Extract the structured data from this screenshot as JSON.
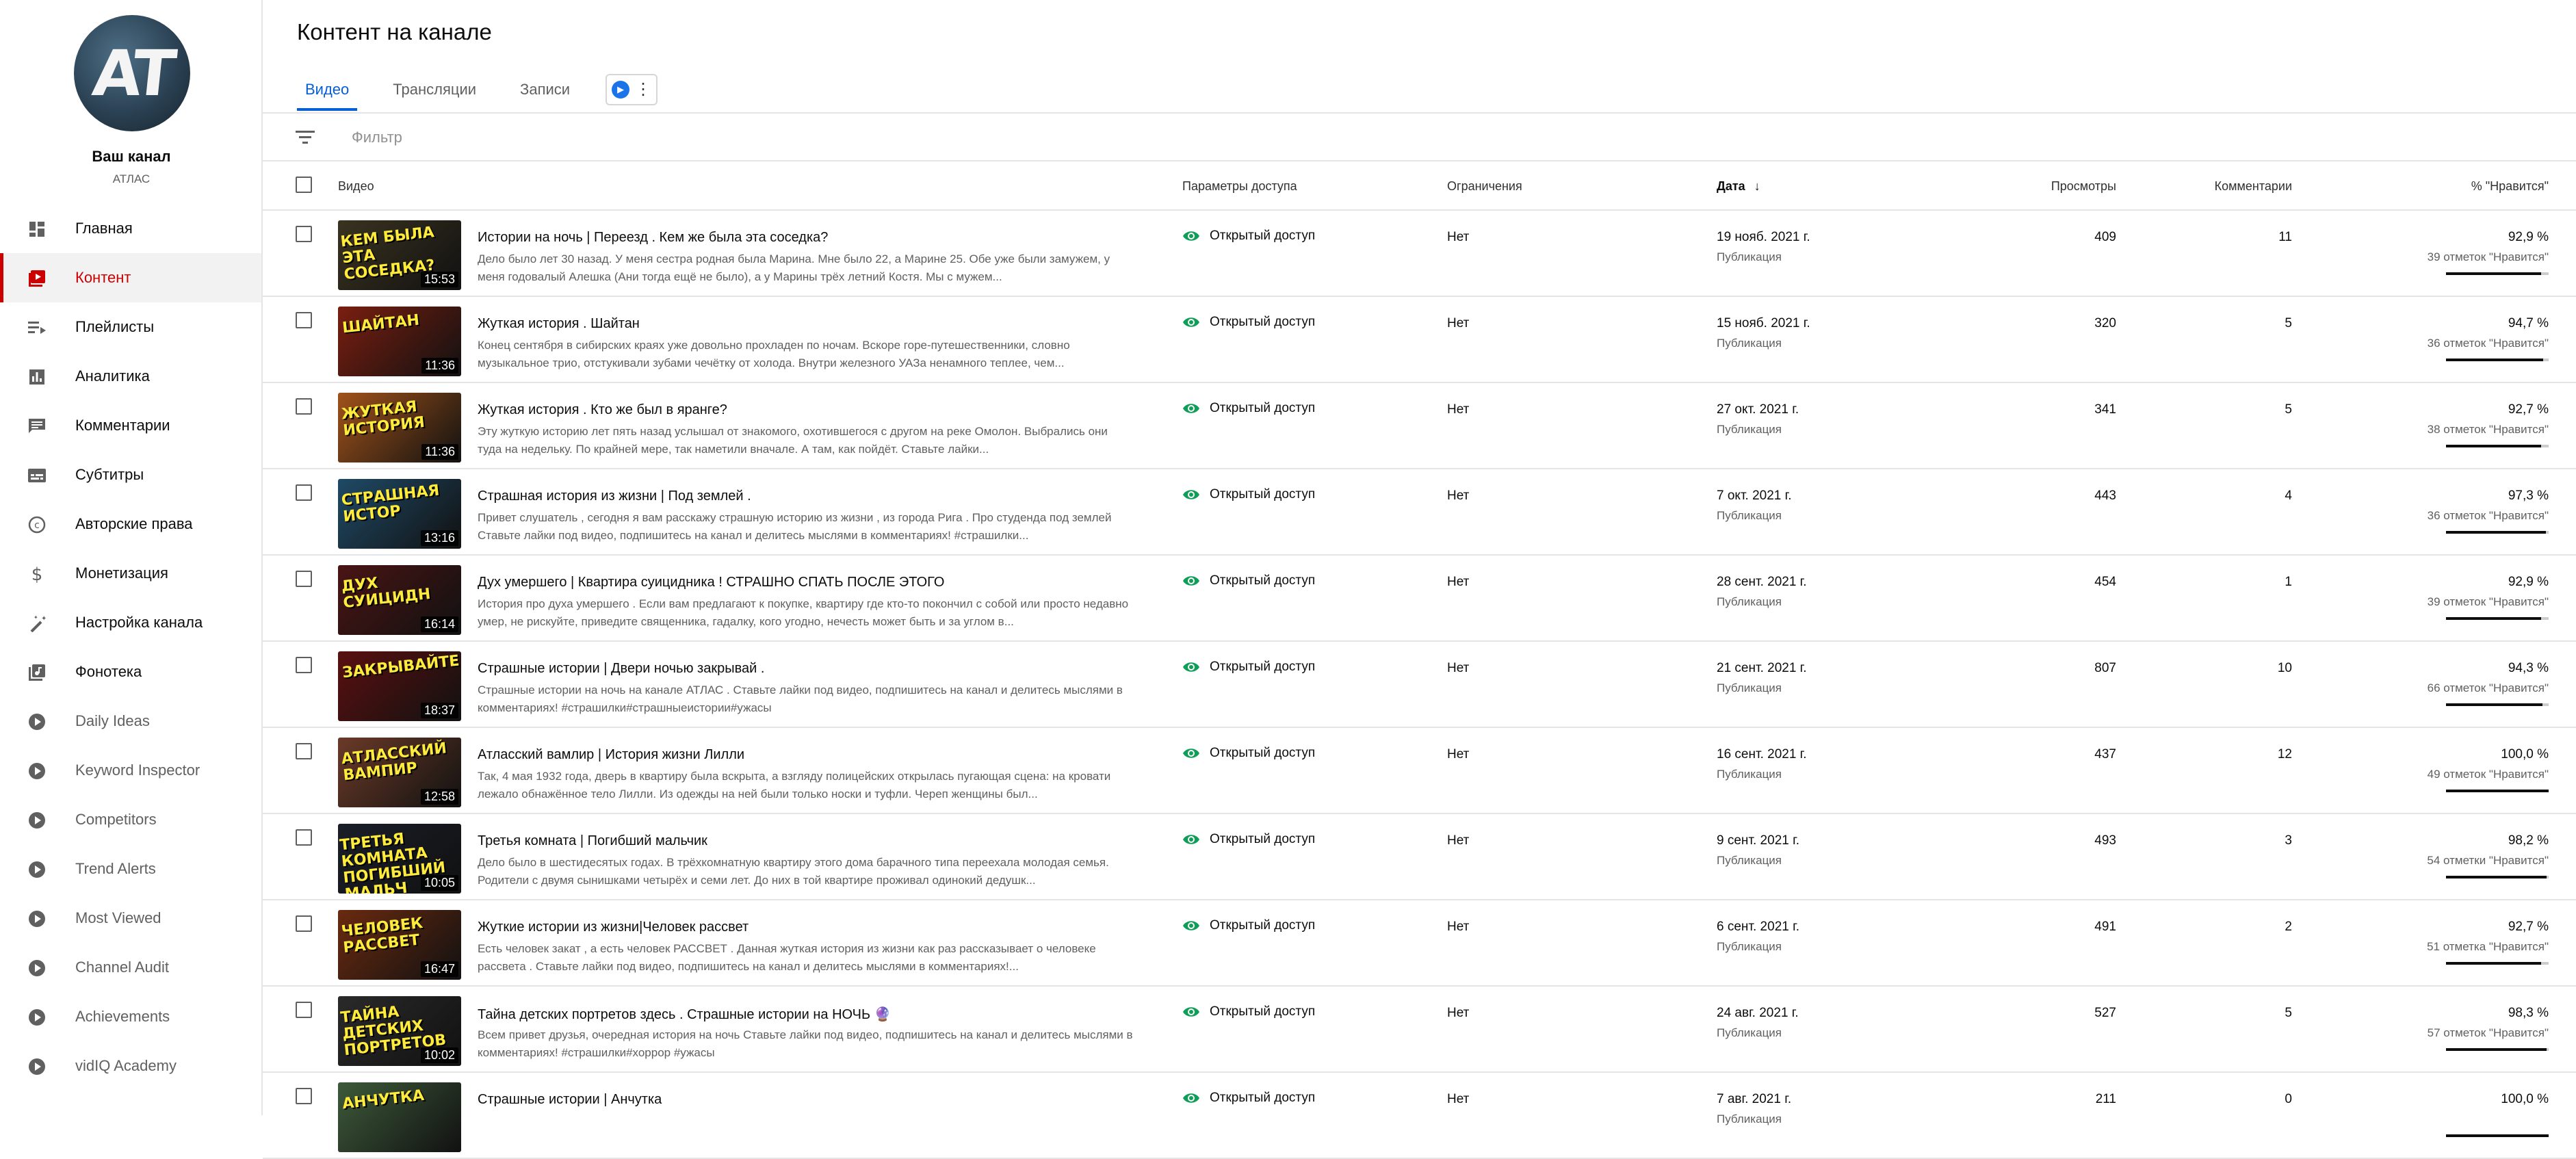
{
  "sidebar": {
    "avatar_text": "AT",
    "channel_title": "Ваш канал",
    "channel_name": "АТЛАС",
    "items": [
      {
        "label": "Главная",
        "icon": "dashboard-icon"
      },
      {
        "label": "Контент",
        "icon": "content-icon",
        "active": true
      },
      {
        "label": "Плейлисты",
        "icon": "playlist-icon"
      },
      {
        "label": "Аналитика",
        "icon": "analytics-icon"
      },
      {
        "label": "Комментарии",
        "icon": "comments-icon"
      },
      {
        "label": "Субтитры",
        "icon": "subtitles-icon"
      },
      {
        "label": "Авторские права",
        "icon": "copyright-icon"
      },
      {
        "label": "Монетизация",
        "icon": "dollar-icon"
      },
      {
        "label": "Настройка канала",
        "icon": "magic-wand-icon"
      },
      {
        "label": "Фонотека",
        "icon": "audio-library-icon"
      },
      {
        "label": "Daily Ideas",
        "icon": "vidiq-icon",
        "ext": true
      },
      {
        "label": "Keyword Inspector",
        "icon": "vidiq-icon",
        "ext": true
      },
      {
        "label": "Competitors",
        "icon": "vidiq-icon",
        "ext": true
      },
      {
        "label": "Trend Alerts",
        "icon": "vidiq-icon",
        "ext": true
      },
      {
        "label": "Most Viewed",
        "icon": "vidiq-icon",
        "ext": true
      },
      {
        "label": "Channel Audit",
        "icon": "vidiq-icon",
        "ext": true
      },
      {
        "label": "Achievements",
        "icon": "vidiq-icon",
        "ext": true
      },
      {
        "label": "vidIQ Academy",
        "icon": "vidiq-icon",
        "ext": true
      }
    ]
  },
  "main": {
    "title": "Контент на канале",
    "tabs": [
      {
        "label": "Видео",
        "active": true
      },
      {
        "label": "Трансляции"
      },
      {
        "label": "Записи"
      }
    ],
    "filter_placeholder": "Фильтр",
    "columns": {
      "video": "Видео",
      "visibility": "Параметры доступа",
      "restrictions": "Ограничения",
      "date": "Дата",
      "views": "Просмотры",
      "comments": "Комментарии",
      "likes": "% \"Нравится\""
    },
    "rows": [
      {
        "title": "Истории на ночь | Переезд . Кем же была эта соседка?",
        "desc": "Дело было лет 30 назад. У меня сестра родная была Марина. Мне было 22, а Марине 25. Обе уже были замужем, у меня годовалый Алешка (Ани тогда ещё не было), а у Марины трёх летний Костя. Мы с мужем...",
        "thumb_text": "КЕМ БЫЛА ЭТА\nСОСЕДКА?",
        "thumb_color": "#3a3320",
        "duration": "15:53",
        "visibility": "Открытый доступ",
        "restrictions": "Нет",
        "date": "19 нояб. 2021 г.",
        "date_status": "Публикация",
        "views": "409",
        "comments": "11",
        "likes": "92,9 %",
        "likes_sub": "39 отметок \"Нравится\"",
        "like_ratio": 0.929
      },
      {
        "title": "Жуткая история . Шайтан",
        "desc": "Конец сентября в сибирских краях уже довольно прохладен по ночам. Вскоре горе-путешественники, словно музыкальное трио, отстукивали зубами чечётку от холода. Внутри железного УАЗа ненамного теплее, чем...",
        "thumb_text": "ШАЙТАН",
        "thumb_color": "#7a1e10",
        "duration": "11:36",
        "visibility": "Открытый доступ",
        "restrictions": "Нет",
        "date": "15 нояб. 2021 г.",
        "date_status": "Публикация",
        "views": "320",
        "comments": "5",
        "likes": "94,7 %",
        "likes_sub": "36 отметок \"Нравится\"",
        "like_ratio": 0.947
      },
      {
        "title": "Жуткая история . Кто же был в яранге?",
        "desc": "Эту жуткую историю лет пять назад услышал от знакомого, охотившегося с другом на реке Омолон. Выбрались они туда на недельку. По крайней мере, так наметили вначале. А там, как пойдёт. Ставьте лайки...",
        "thumb_text": "ЖУТКАЯ\nИСТОРИЯ",
        "thumb_color": "#a0521a",
        "duration": "11:36",
        "visibility": "Открытый доступ",
        "restrictions": "Нет",
        "date": "27 окт. 2021 г.",
        "date_status": "Публикация",
        "views": "341",
        "comments": "5",
        "likes": "92,7 %",
        "likes_sub": "38 отметок \"Нравится\"",
        "like_ratio": 0.927
      },
      {
        "title": "Страшная история из жизни | Под землей .",
        "desc": "Привет слушатель , сегодня я вам расскажу страшную историю из жизни , из города Рига . Про студенда под землей Ставьте лайки под видео, подпишитесь на канал и делитесь мыслями в комментариях! #страшилки...",
        "thumb_text": "СТРАШНАЯ\nИСТОР",
        "thumb_color": "#1f4a66",
        "duration": "13:16",
        "visibility": "Открытый доступ",
        "restrictions": "Нет",
        "date": "7 окт. 2021 г.",
        "date_status": "Публикация",
        "views": "443",
        "comments": "4",
        "likes": "97,3 %",
        "likes_sub": "36 отметок \"Нравится\"",
        "like_ratio": 0.973
      },
      {
        "title": "Дух умершего | Квартира суицидника ! СТРАШНО СПАТЬ ПОСЛЕ ЭТОГО",
        "desc": "История про духа умершего . Если вам предлагают к покупке, квартиру где кто-то покончил с собой или просто недавно умер, не рискуйте, приведите священника, гадалку, кого угодно, нечесть может быть и за углом в...",
        "thumb_text": "ДУХ СУИЦИДН",
        "thumb_color": "#4a1414",
        "duration": "16:14",
        "visibility": "Открытый доступ",
        "restrictions": "Нет",
        "date": "28 сент. 2021 г.",
        "date_status": "Публикация",
        "views": "454",
        "comments": "1",
        "likes": "92,9 %",
        "likes_sub": "39 отметок \"Нравится\"",
        "like_ratio": 0.929
      },
      {
        "title": "Страшные истории | Двери ночью закрывай .",
        "desc": "Страшные истории на ночь на канале АТЛАС . Ставьте лайки под видео, подпишитесь на канал и делитесь мыслями в комментариях! #страшилки#страшныеистории#ужасы",
        "thumb_text": "ЗАКРЫВАЙТЕ",
        "thumb_color": "#5a1010",
        "duration": "18:37",
        "visibility": "Открытый доступ",
        "restrictions": "Нет",
        "date": "21 сент. 2021 г.",
        "date_status": "Публикация",
        "views": "807",
        "comments": "10",
        "likes": "94,3 %",
        "likes_sub": "66 отметок \"Нравится\"",
        "like_ratio": 0.943
      },
      {
        "title": "Атласский вамлир | История жизни Лилли",
        "desc": "Так, 4 мая 1932 года, дверь в квартиру была вскрыта, а взгляду полицейских открылась пугающая сцена: на кровати лежало обнажённое тело Лилли. Из одежды на ней были только носки и туфли. Череп женщины был...",
        "thumb_text": "АТЛАССКИЙ ВАМПИР",
        "thumb_color": "#6b3a28",
        "duration": "12:58",
        "visibility": "Открытый доступ",
        "restrictions": "Нет",
        "date": "16 сент. 2021 г.",
        "date_status": "Публикация",
        "views": "437",
        "comments": "12",
        "likes": "100,0 %",
        "likes_sub": "49 отметок \"Нравится\"",
        "like_ratio": 1.0
      },
      {
        "title": "Третья комната | Погибший мальчик",
        "desc": "Дело было в шестидесятых годах. В трёхкомнатную квартиру этого дома барачного типа переехала молодая семья. Родители с двумя сынишками четырёх и семи лет. До них в той квартире проживал одинокий дедушк...",
        "thumb_text": "ТРЕТЬЯ КОМНАТА\nПОГИБШИЙ МАЛЬЧ",
        "thumb_color": "#1a1e28",
        "duration": "10:05",
        "visibility": "Открытый доступ",
        "restrictions": "Нет",
        "date": "9 сент. 2021 г.",
        "date_status": "Публикация",
        "views": "493",
        "comments": "3",
        "likes": "98,2 %",
        "likes_sub": "54 отметки \"Нравится\"",
        "like_ratio": 0.982
      },
      {
        "title": "Жуткие истории из жизни|Человек рассвет",
        "desc": "Есть человек закат , а есть человек РАССВЕТ . Данная жуткая история из жизни как раз рассказывает о человеке рассвета . Ставьте лайки под видео, подпишитесь на канал и делитесь мыслями в комментариях!...",
        "thumb_text": "ЧЕЛОВЕК\nРАССВЕТ",
        "thumb_color": "#6a2a10",
        "duration": "16:47",
        "visibility": "Открытый доступ",
        "restrictions": "Нет",
        "date": "6 сент. 2021 г.",
        "date_status": "Публикация",
        "views": "491",
        "comments": "2",
        "likes": "92,7 %",
        "likes_sub": "51 отметка \"Нравится\"",
        "like_ratio": 0.927
      },
      {
        "title": "Тайна детских портретов здесь . Страшные истории на НОЧЬ 🔮",
        "desc": "Всем привет друзья, очередная история на ночь Ставьте лайки под видео, подпишитесь на канал и делитесь мыслями в комментариях! #страшилки#хоррор #ужасы",
        "thumb_text": "ТАЙНА ДЕТСКИХ\nПОРТРЕТОВ",
        "thumb_color": "#2a2a2a",
        "duration": "10:02",
        "visibility": "Открытый доступ",
        "restrictions": "Нет",
        "date": "24 авг. 2021 г.",
        "date_status": "Публикация",
        "views": "527",
        "comments": "5",
        "likes": "98,3 %",
        "likes_sub": "57 отметок \"Нравится\"",
        "like_ratio": 0.983
      },
      {
        "title": "Страшные истории | Анчутка",
        "desc": "",
        "thumb_text": "АНЧУТКА",
        "thumb_color": "#3d5a3a",
        "duration": "",
        "visibility": "Открытый доступ",
        "restrictions": "Нет",
        "date": "7 авг. 2021 г.",
        "date_status": "Публикация",
        "views": "211",
        "comments": "0",
        "likes": "100,0 %",
        "likes_sub": "",
        "like_ratio": 1.0
      }
    ]
  },
  "colors": {
    "accent": "#065fd4",
    "active_nav": "#cc0000",
    "visibility_green": "#0f9d58"
  }
}
